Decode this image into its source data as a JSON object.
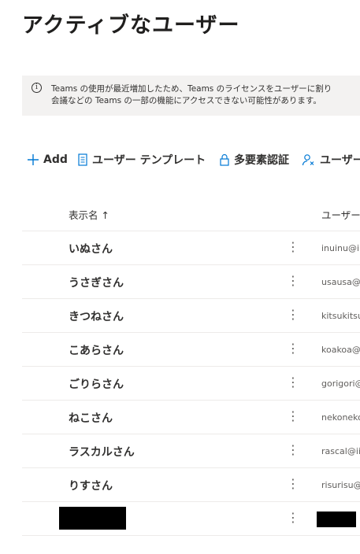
{
  "page": {
    "title": "アクティブなユーザー"
  },
  "banner": {
    "icon": "info-icon",
    "line1": "Teams の使用が最近増加したため、Teams のライセンスをユーザーに割り",
    "line2": "会議などの Teams の一部の機能にアクセスできない可能性があります。"
  },
  "toolbar": {
    "add_label": "Add",
    "template_label": "ユーザー テンプレート",
    "mfa_label": "多要素認証",
    "user_label": "ユーザー"
  },
  "table": {
    "columns": {
      "display_name": "表示名 ↑",
      "username": "ユーザー"
    },
    "rows": [
      {
        "name": "いぬさん",
        "upn": "inuinu@ii"
      },
      {
        "name": "うさぎさん",
        "upn": "usausa@"
      },
      {
        "name": "きつねさん",
        "upn": "kitsukitsu"
      },
      {
        "name": "こあらさん",
        "upn": "koakoa@"
      },
      {
        "name": "ごりらさん",
        "upn": "gorigori@"
      },
      {
        "name": "ねこさん",
        "upn": "nekoneko"
      },
      {
        "name": "ラスカルさん",
        "upn": "rascal@ii"
      },
      {
        "name": "りすさん",
        "upn": "risurisu@"
      },
      {
        "name": "",
        "upn": "",
        "redacted": true
      }
    ]
  }
}
